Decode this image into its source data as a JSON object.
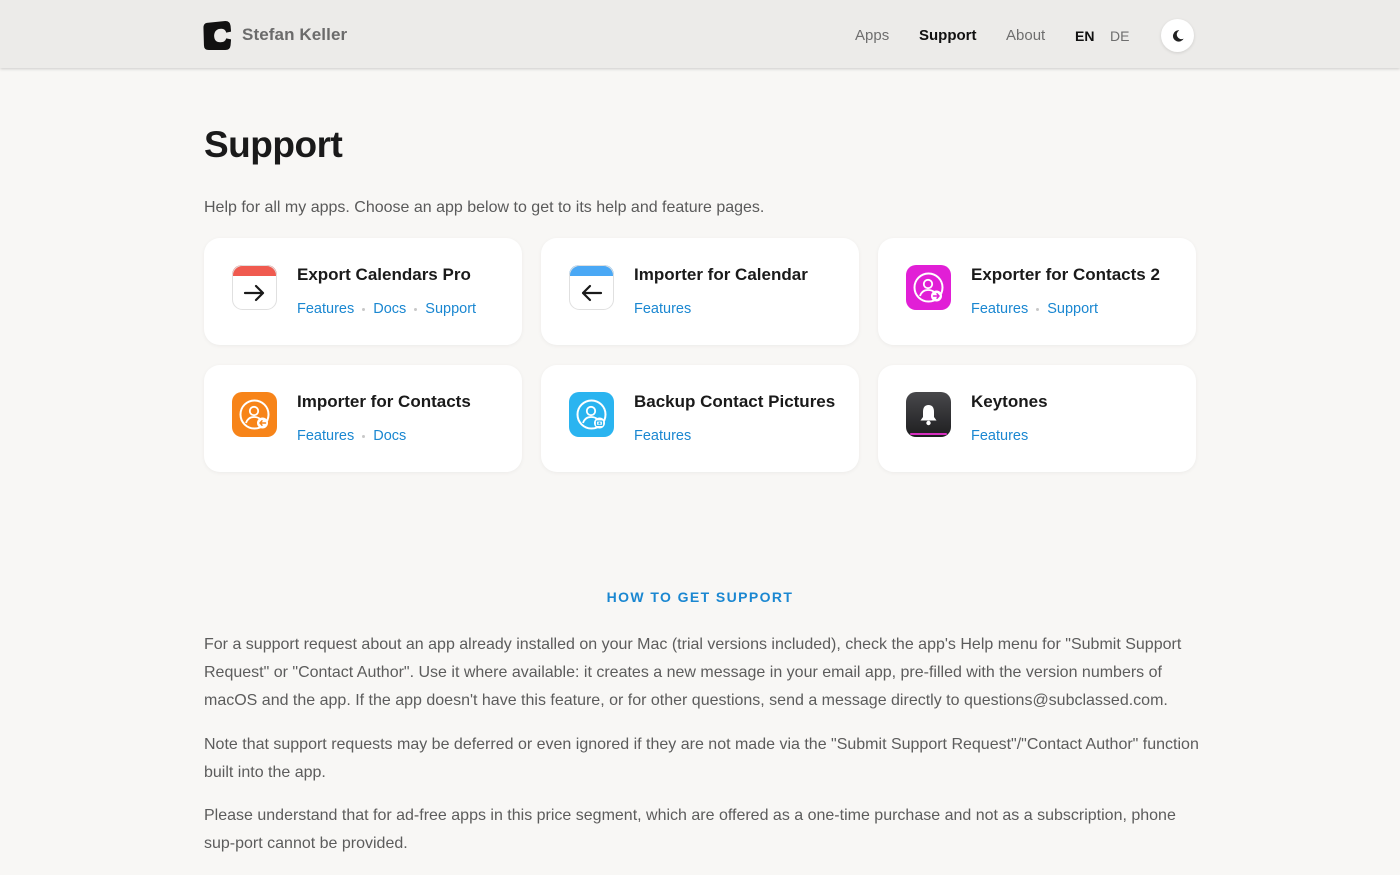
{
  "header": {
    "brand_name": "Stefan Keller",
    "nav": {
      "apps": "Apps",
      "support": "Support",
      "about": "About"
    },
    "lang": {
      "en": "EN",
      "de": "DE"
    },
    "theme_icon": "moon-icon"
  },
  "page": {
    "title": "Support",
    "intro": "Help for all my apps. Choose an app below to get to its help and feature pages."
  },
  "apps": [
    {
      "name": "Export Calendars Pro",
      "icon": "calendar-export-icon",
      "links": [
        "Features",
        "Docs",
        "Support"
      ],
      "accent": "#f05a4f"
    },
    {
      "name": "Importer for Calendar",
      "icon": "calendar-import-icon",
      "links": [
        "Features"
      ],
      "accent": "#4aa8f5"
    },
    {
      "name": "Exporter for Contacts 2",
      "icon": "contacts-export-icon",
      "links": [
        "Features",
        "Support"
      ],
      "accent": "#e11fd6"
    },
    {
      "name": "Importer for Contacts",
      "icon": "contacts-import-icon",
      "links": [
        "Features",
        "Docs"
      ],
      "accent": "#f78419"
    },
    {
      "name": "Backup Contact Pictures",
      "icon": "contact-pictures-icon",
      "links": [
        "Features"
      ],
      "accent": "#2ab4f0"
    },
    {
      "name": "Keytones",
      "icon": "bell-icon",
      "links": [
        "Features"
      ],
      "accent": "#2e2e30"
    }
  ],
  "support_section": {
    "heading": "HOW TO GET SUPPORT",
    "paragraphs": [
      "For a support request about an app already installed on your Mac (trial versions included), check the app's Help menu for \"Submit Support Request\" or \"Contact Author\". Use it where available: it creates a new message in your email app, pre-filled with the version numbers of macOS and the app. If the app doesn't have this feature, or for other questions, send a message directly to questions@subclassed.com.",
      "Note that support requests may be deferred or even ignored if they are not made via the \"Submit Support Request\"/\"Contact Author\" function built into the app.",
      "Please understand that for ad-free apps in this price segment, which are offered as a one-time purchase and not as a subscription, phone sup-port cannot be provided."
    ]
  },
  "colors": {
    "link": "#1a87d1",
    "background": "#f8f7f5",
    "header_bg": "#ecebe9"
  }
}
